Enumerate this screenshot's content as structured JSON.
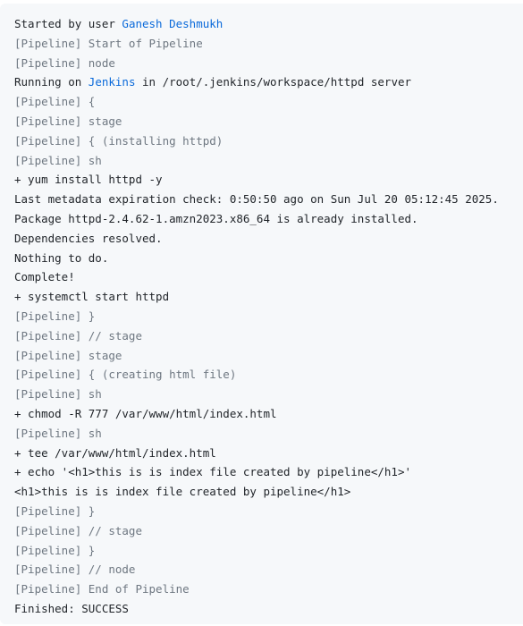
{
  "console": {
    "lines": [
      {
        "type": "user",
        "prefix": "Started by user ",
        "user": "Ganesh Deshmukh"
      },
      {
        "type": "pipeline",
        "text": "[Pipeline] Start of Pipeline"
      },
      {
        "type": "pipeline",
        "text": "[Pipeline] node"
      },
      {
        "type": "node",
        "prefix": "Running on ",
        "node": "Jenkins",
        "suffix": " in /root/.jenkins/workspace/httpd server"
      },
      {
        "type": "pipeline",
        "text": "[Pipeline] {"
      },
      {
        "type": "pipeline",
        "text": "[Pipeline] stage"
      },
      {
        "type": "pipeline",
        "text": "[Pipeline] { (installing httpd)"
      },
      {
        "type": "pipeline",
        "text": "[Pipeline] sh"
      },
      {
        "type": "plain",
        "text": "+ yum install httpd -y"
      },
      {
        "type": "plain",
        "text": "Last metadata expiration check: 0:50:50 ago on Sun Jul 20 05:12:45 2025."
      },
      {
        "type": "plain",
        "text": "Package httpd-2.4.62-1.amzn2023.x86_64 is already installed."
      },
      {
        "type": "plain",
        "text": "Dependencies resolved."
      },
      {
        "type": "plain",
        "text": "Nothing to do."
      },
      {
        "type": "plain",
        "text": "Complete!"
      },
      {
        "type": "plain",
        "text": "+ systemctl start httpd"
      },
      {
        "type": "pipeline",
        "text": "[Pipeline] }"
      },
      {
        "type": "pipeline",
        "text": "[Pipeline] // stage"
      },
      {
        "type": "pipeline",
        "text": "[Pipeline] stage"
      },
      {
        "type": "pipeline",
        "text": "[Pipeline] { (creating html file)"
      },
      {
        "type": "pipeline",
        "text": "[Pipeline] sh"
      },
      {
        "type": "plain",
        "text": "+ chmod -R 777 /var/www/html/index.html"
      },
      {
        "type": "pipeline",
        "text": "[Pipeline] sh"
      },
      {
        "type": "plain",
        "text": "+ tee /var/www/html/index.html"
      },
      {
        "type": "plain",
        "text": "+ echo '<h1>this is is index file created by pipeline</h1>'"
      },
      {
        "type": "plain",
        "text": "<h1>this is is index file created by pipeline</h1>"
      },
      {
        "type": "pipeline",
        "text": "[Pipeline] }"
      },
      {
        "type": "pipeline",
        "text": "[Pipeline] // stage"
      },
      {
        "type": "pipeline",
        "text": "[Pipeline] }"
      },
      {
        "type": "pipeline",
        "text": "[Pipeline] // node"
      },
      {
        "type": "pipeline",
        "text": "[Pipeline] End of Pipeline"
      },
      {
        "type": "plain",
        "text": "Finished: SUCCESS"
      }
    ]
  }
}
